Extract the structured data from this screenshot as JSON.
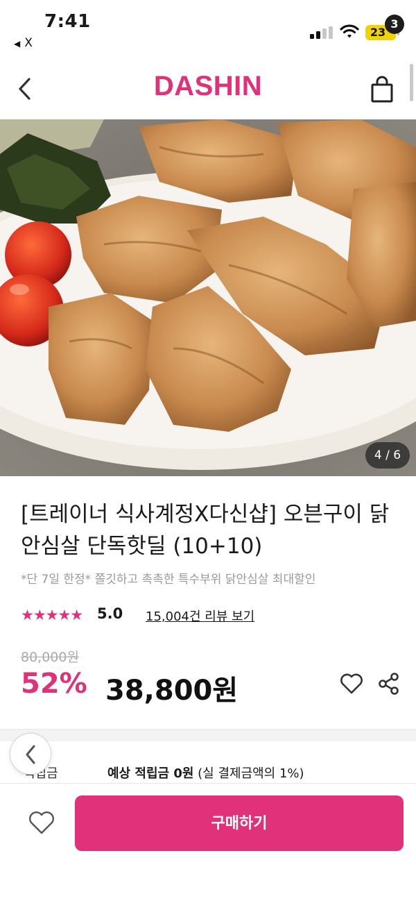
{
  "status_bar": {
    "time": "7:41",
    "back_app_label": "X",
    "battery": "23",
    "icons": [
      "signal-icon",
      "wifi-icon",
      "battery-charging-icon"
    ]
  },
  "header": {
    "logo": "DASHIN",
    "cart_count": "3",
    "icons": [
      "back-chevron-icon",
      "cart-bag-icon"
    ]
  },
  "product": {
    "image_counter": "4 / 6",
    "title": "[트레이너 식사계정X다신샵] 오븐구이 닭안심살 단독핫딜 (10+10)",
    "subtitle": "*단 7일 한정* 쫄깃하고 촉촉한 특수부위 닭안심살 최대할인",
    "stars": "★★★★★",
    "rating": "5.0",
    "review_link": "15,004건 리뷰 보기",
    "original_price": "80,000원",
    "discount": "52%",
    "sale_price": "38,800원",
    "points_label": "적립금",
    "points_value_bold": "예상 적립금 0원",
    "points_value_rest": " (실 결제금액의 1%)"
  },
  "bottom_bar": {
    "buy_label": "구매하기"
  },
  "colors": {
    "brand": "#e0317a",
    "text": "#1a1a1a",
    "muted": "#9a9a9a"
  }
}
